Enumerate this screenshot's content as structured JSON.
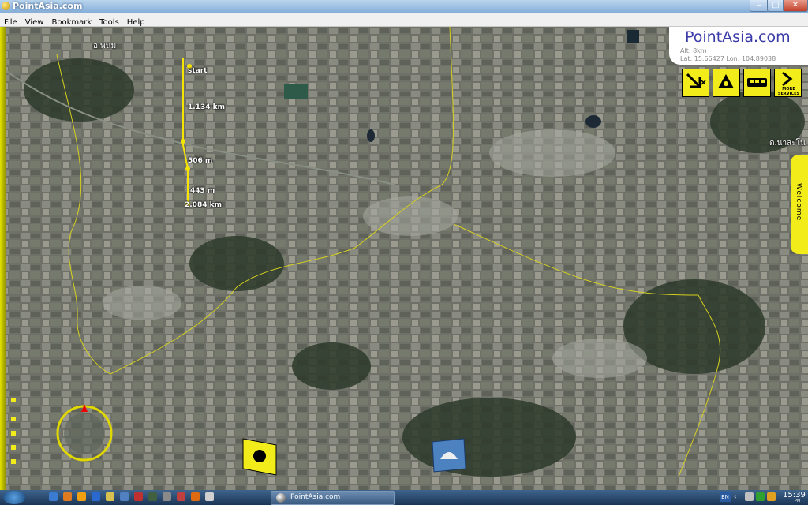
{
  "window": {
    "title": "PointAsia.com",
    "minimize_glyph": "–",
    "maximize_glyph": "□",
    "close_glyph": "✕"
  },
  "menu": [
    "File",
    "View",
    "Bookmark",
    "Tools",
    "Help"
  ],
  "map": {
    "route_labels": {
      "start": "start",
      "seg1": "1.134 km",
      "seg2": "506 m",
      "seg3": "443 m",
      "total": "2.084 km"
    },
    "place_left": "อ.พนม",
    "place_right": "ต.นาสะโน"
  },
  "brand": {
    "name": "PointAsia.com",
    "alt": "Alt: 8km",
    "coords": "Lat: 15.66427 Lon: 104.89038"
  },
  "services": [
    {
      "icon": "arrow-tools-icon",
      "label": ""
    },
    {
      "icon": "radiation-icon",
      "label": ""
    },
    {
      "icon": "bus-icon",
      "label": ""
    },
    {
      "icon": "more-services-icon",
      "label": "MORE SERVICES"
    }
  ],
  "welcome_tab": "Welcome",
  "taskbar": {
    "active_task": "PointAsia.com",
    "language": "EN",
    "time": "15:39",
    "ampm": "PM"
  },
  "colors": {
    "accent_yellow": "#f2ec1a",
    "brand_blue": "#3a3aa8"
  }
}
